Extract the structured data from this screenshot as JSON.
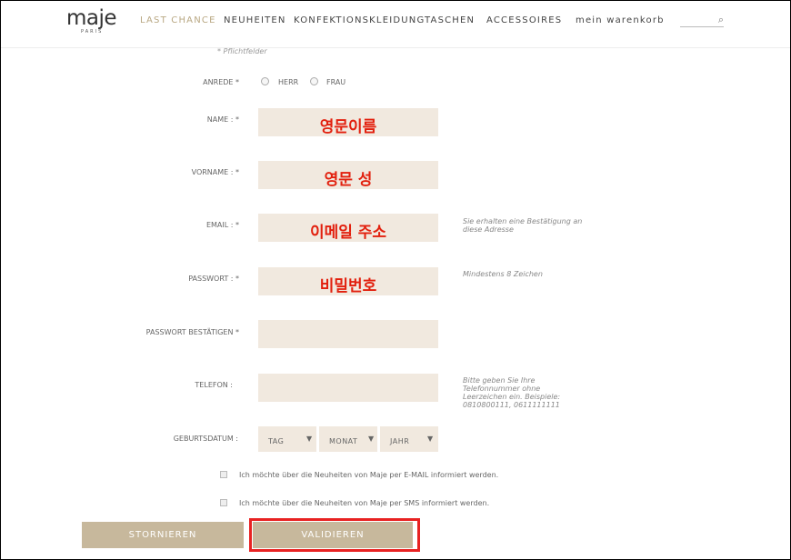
{
  "header": {
    "logo": "maje",
    "logo_sub": "PARIS",
    "nav": [
      "LAST CHANCE",
      "NEUHEITEN",
      "KONFEKTIONSKLEIDUNG",
      "TASCHEN",
      "ACCESSOIRES",
      "mein warenkorb"
    ],
    "search_placeholder": ""
  },
  "form": {
    "required_note": "* Pflichtfelder",
    "anrede": {
      "label": "ANREDE *",
      "options": [
        "HERR",
        "FRAU"
      ]
    },
    "name": {
      "label": "NAME : *",
      "value": "영문이름"
    },
    "vorname": {
      "label": "VORNAME : *",
      "value": "영문 성"
    },
    "email": {
      "label": "EMAIL : *",
      "value": "이메일 주소",
      "hint": "Sie erhalten eine Bestätigung an diese Adresse"
    },
    "passwort": {
      "label": "PASSWORT : *",
      "value": "비밀번호",
      "hint": "Mindestens 8 Zeichen"
    },
    "passwort_confirm": {
      "label": "PASSWORT BESTÄTIGEN *",
      "value": ""
    },
    "telefon": {
      "label": "TELEFON :",
      "value": "",
      "hint": "Bitte geben Sie Ihre Telefonnummer ohne Leerzeichen ein. Beispiele: 0810800111, 0611111111"
    },
    "birthdate": {
      "label": "GEBURTSDATUM :",
      "day": "TAG",
      "month": "MONAT",
      "year": "JAHR"
    },
    "newsletter_email": "Ich möchte über die Neuheiten von Maje per E-MAIL informiert werden.",
    "newsletter_sms": "Ich möchte über die Neuheiten von Maje per SMS informiert werden.",
    "cancel_label": "STORNIEREN",
    "validate_label": "VALIDIEREN"
  }
}
